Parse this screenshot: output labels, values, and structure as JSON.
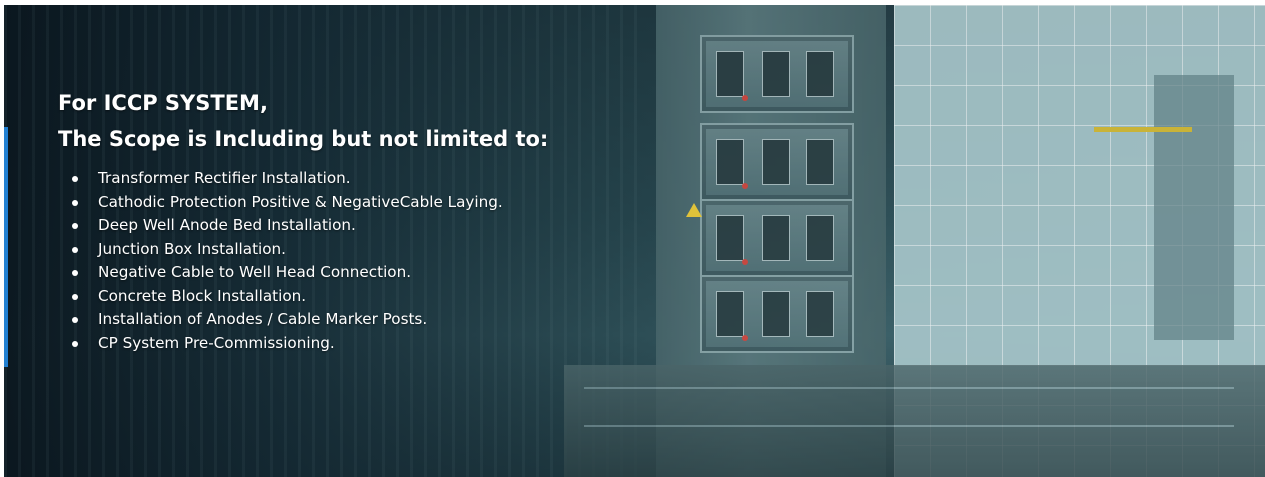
{
  "scope": {
    "title_line1": "For ICCP SYSTEM,",
    "title_line2": "The Scope is Including but not limited to:",
    "items": [
      "Transformer Rectifier Installation.",
      "Cathodic Protection Positive & NegativeCable Laying.",
      "Deep Well Anode Bed Installation.",
      "Junction Box Installation.",
      "Negative Cable to Well Head Connection.",
      "Concrete Block Installation.",
      "Installation of Anodes / Cable Marker Posts.",
      "CP System Pre-Commissioning."
    ]
  },
  "colors": {
    "accent": "#1c7fd6",
    "text": "#ffffff"
  },
  "background": {
    "subject": "electrical-panel-room-photo"
  }
}
